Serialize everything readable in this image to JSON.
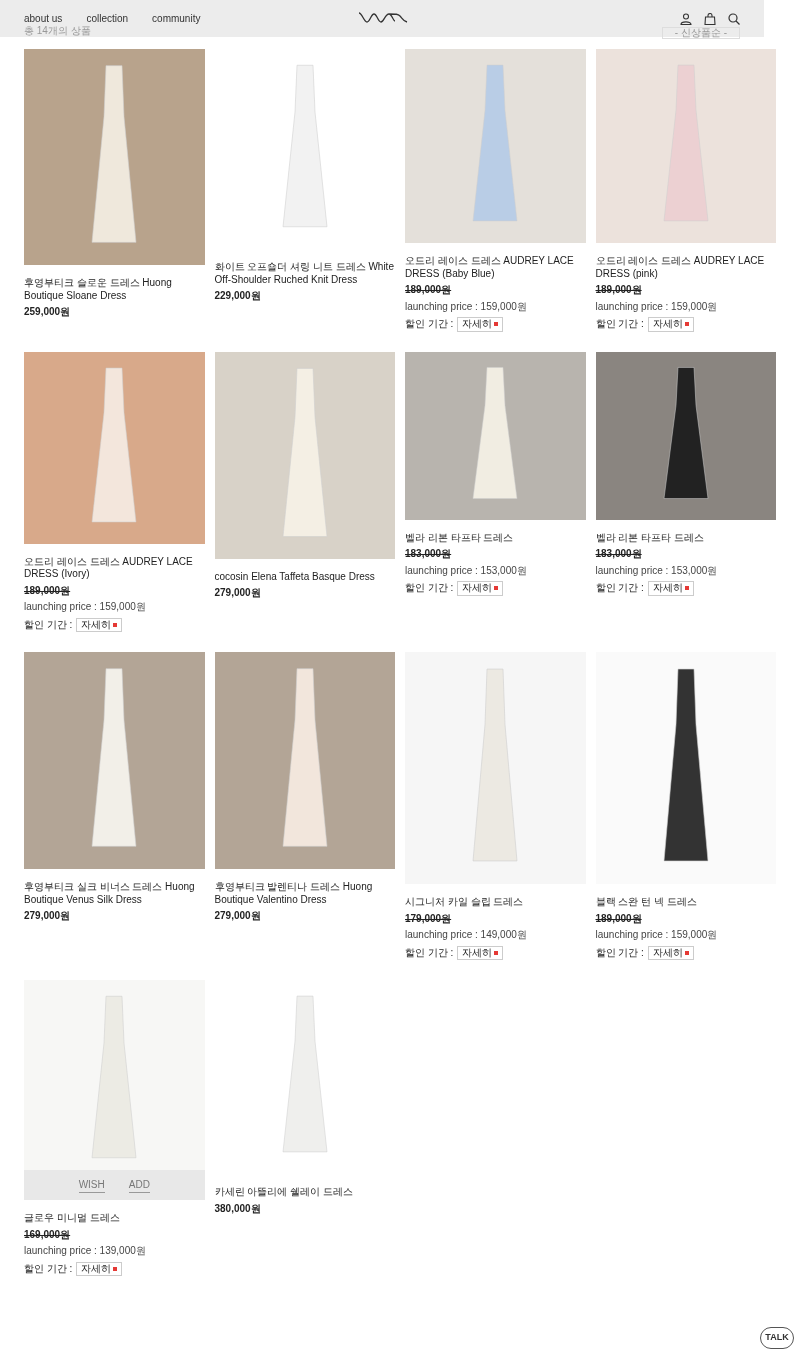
{
  "nav": {
    "links": [
      "about us",
      "collection",
      "community"
    ]
  },
  "listing": {
    "count": "총 14개의 상품",
    "sort": "- 신상품순 -"
  },
  "products": [
    {
      "name": "후영부티크 슬로운 드레스 Huong Boutique Sloane Dress",
      "price": "259,000원"
    },
    {
      "name": "화이트 오프숄더 셔링 니트 드레스 White Off-Shoulder Ruched Knit Dress",
      "price": "229,000원"
    },
    {
      "name": "오드리 레이스 드레스 AUDREY LACE DRESS (Baby Blue)",
      "original_price": "189,000원",
      "launching": "launching price : 159,000원",
      "discount_label": "할인 기간 :",
      "detail": "자세히"
    },
    {
      "name": "오드리 레이스 드레스 AUDREY LACE DRESS (pink)",
      "original_price": "189,000원",
      "launching": "launching price : 159,000원",
      "discount_label": "할인 기간 :",
      "detail": "자세히"
    },
    {
      "name": "오드리 레이스 드레스 AUDREY LACE DRESS (Ivory)",
      "original_price": "189,000원",
      "launching": "launching price : 159,000원",
      "discount_label": "할인 기간 :",
      "detail": "자세히"
    },
    {
      "name": "cocosin Elena Taffeta Basque Dress",
      "price": "279,000원"
    },
    {
      "name": "벨라 리본 타프타 드레스",
      "original_price": "183,000원",
      "launching": "launching price : 153,000원",
      "discount_label": "할인 기간 :",
      "detail": "자세히"
    },
    {
      "name": "벨라 리본 타프타 드레스",
      "original_price": "183,000원",
      "launching": "launching price : 153,000원",
      "discount_label": "할인 기간 :",
      "detail": "자세히"
    },
    {
      "name": "후영부티크 실크 비너스 드레스 Huong Boutique Venus Silk Dress",
      "price": "279,000원"
    },
    {
      "name": "후영부티크 발렌티나 드레스 Huong Boutique Valentino Dress",
      "price": "279,000원"
    },
    {
      "name": "시그니처 카일 슬립 드레스",
      "original_price": "179,000원",
      "launching": "launching price : 149,000원",
      "discount_label": "할인 기간 :",
      "detail": "자세히"
    },
    {
      "name": "블랙 스완 턴 넥 드레스",
      "original_price": "189,000원",
      "launching": "launching price : 159,000원",
      "discount_label": "할인 기간 :",
      "detail": "자세히"
    },
    {
      "name": "글로우 미니멀 드레스",
      "original_price": "169,000원",
      "launching": "launching price : 139,000원",
      "discount_label": "할인 기간 :",
      "detail": "자세히",
      "hover": {
        "wish": "WISH",
        "add": "ADD"
      }
    },
    {
      "name": "카세린 아뜰리에 쉘레이 드레스",
      "price": "380,000원"
    }
  ],
  "chat_button": "TALK"
}
